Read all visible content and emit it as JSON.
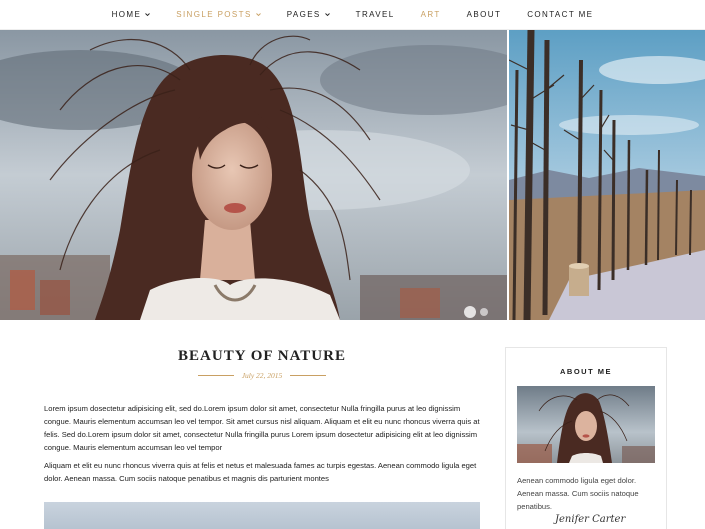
{
  "nav": {
    "items": [
      {
        "label": "HOME",
        "has_dropdown": true,
        "active": false
      },
      {
        "label": "SINGLE POSTS",
        "has_dropdown": true,
        "active": true
      },
      {
        "label": "PAGES",
        "has_dropdown": true,
        "active": false
      },
      {
        "label": "TRAVEL",
        "has_dropdown": false,
        "active": false
      },
      {
        "label": "ART",
        "has_dropdown": false,
        "active": true
      },
      {
        "label": "ABOUT",
        "has_dropdown": false,
        "active": false
      },
      {
        "label": "CONTACT ME",
        "has_dropdown": false,
        "active": false
      }
    ]
  },
  "colors": {
    "accent": "#c9a063",
    "text": "#222222",
    "border": "#e6e6e6"
  },
  "post": {
    "title": "BEAUTY OF NATURE",
    "date": "July 22, 2015",
    "paragraphs": [
      "Lorem ipsum dosectetur adipisicing elit, sed do.Lorem ipsum dolor sit amet, consectetur Nulla fringilla purus at leo dignissim congue. Mauris elementum accumsan leo vel tempor. Sit amet cursus nisl aliquam. Aliquam et elit eu nunc rhoncus viverra quis at felis. Sed do.Lorem ipsum dolor sit amet, consectetur Nulla fringilla purus Lorem ipsum dosectetur adipisicing elit at leo dignissim congue. Mauris elementum accumsan leo vel tempor",
      "Aliquam et elit eu nunc rhoncus viverra quis at felis et netus et malesuada fames ac turpis egestas. Aenean commodo ligula eget dolor. Aenean massa. Cum sociis natoque penatibus et magnis dis parturient montes"
    ]
  },
  "sidebar": {
    "about_title": "ABOUT ME",
    "about_text": "Aenean commodo ligula eget dolor. Aenean massa. Cum sociis natoque penatibus.",
    "signature": "Jenifer Carter"
  }
}
